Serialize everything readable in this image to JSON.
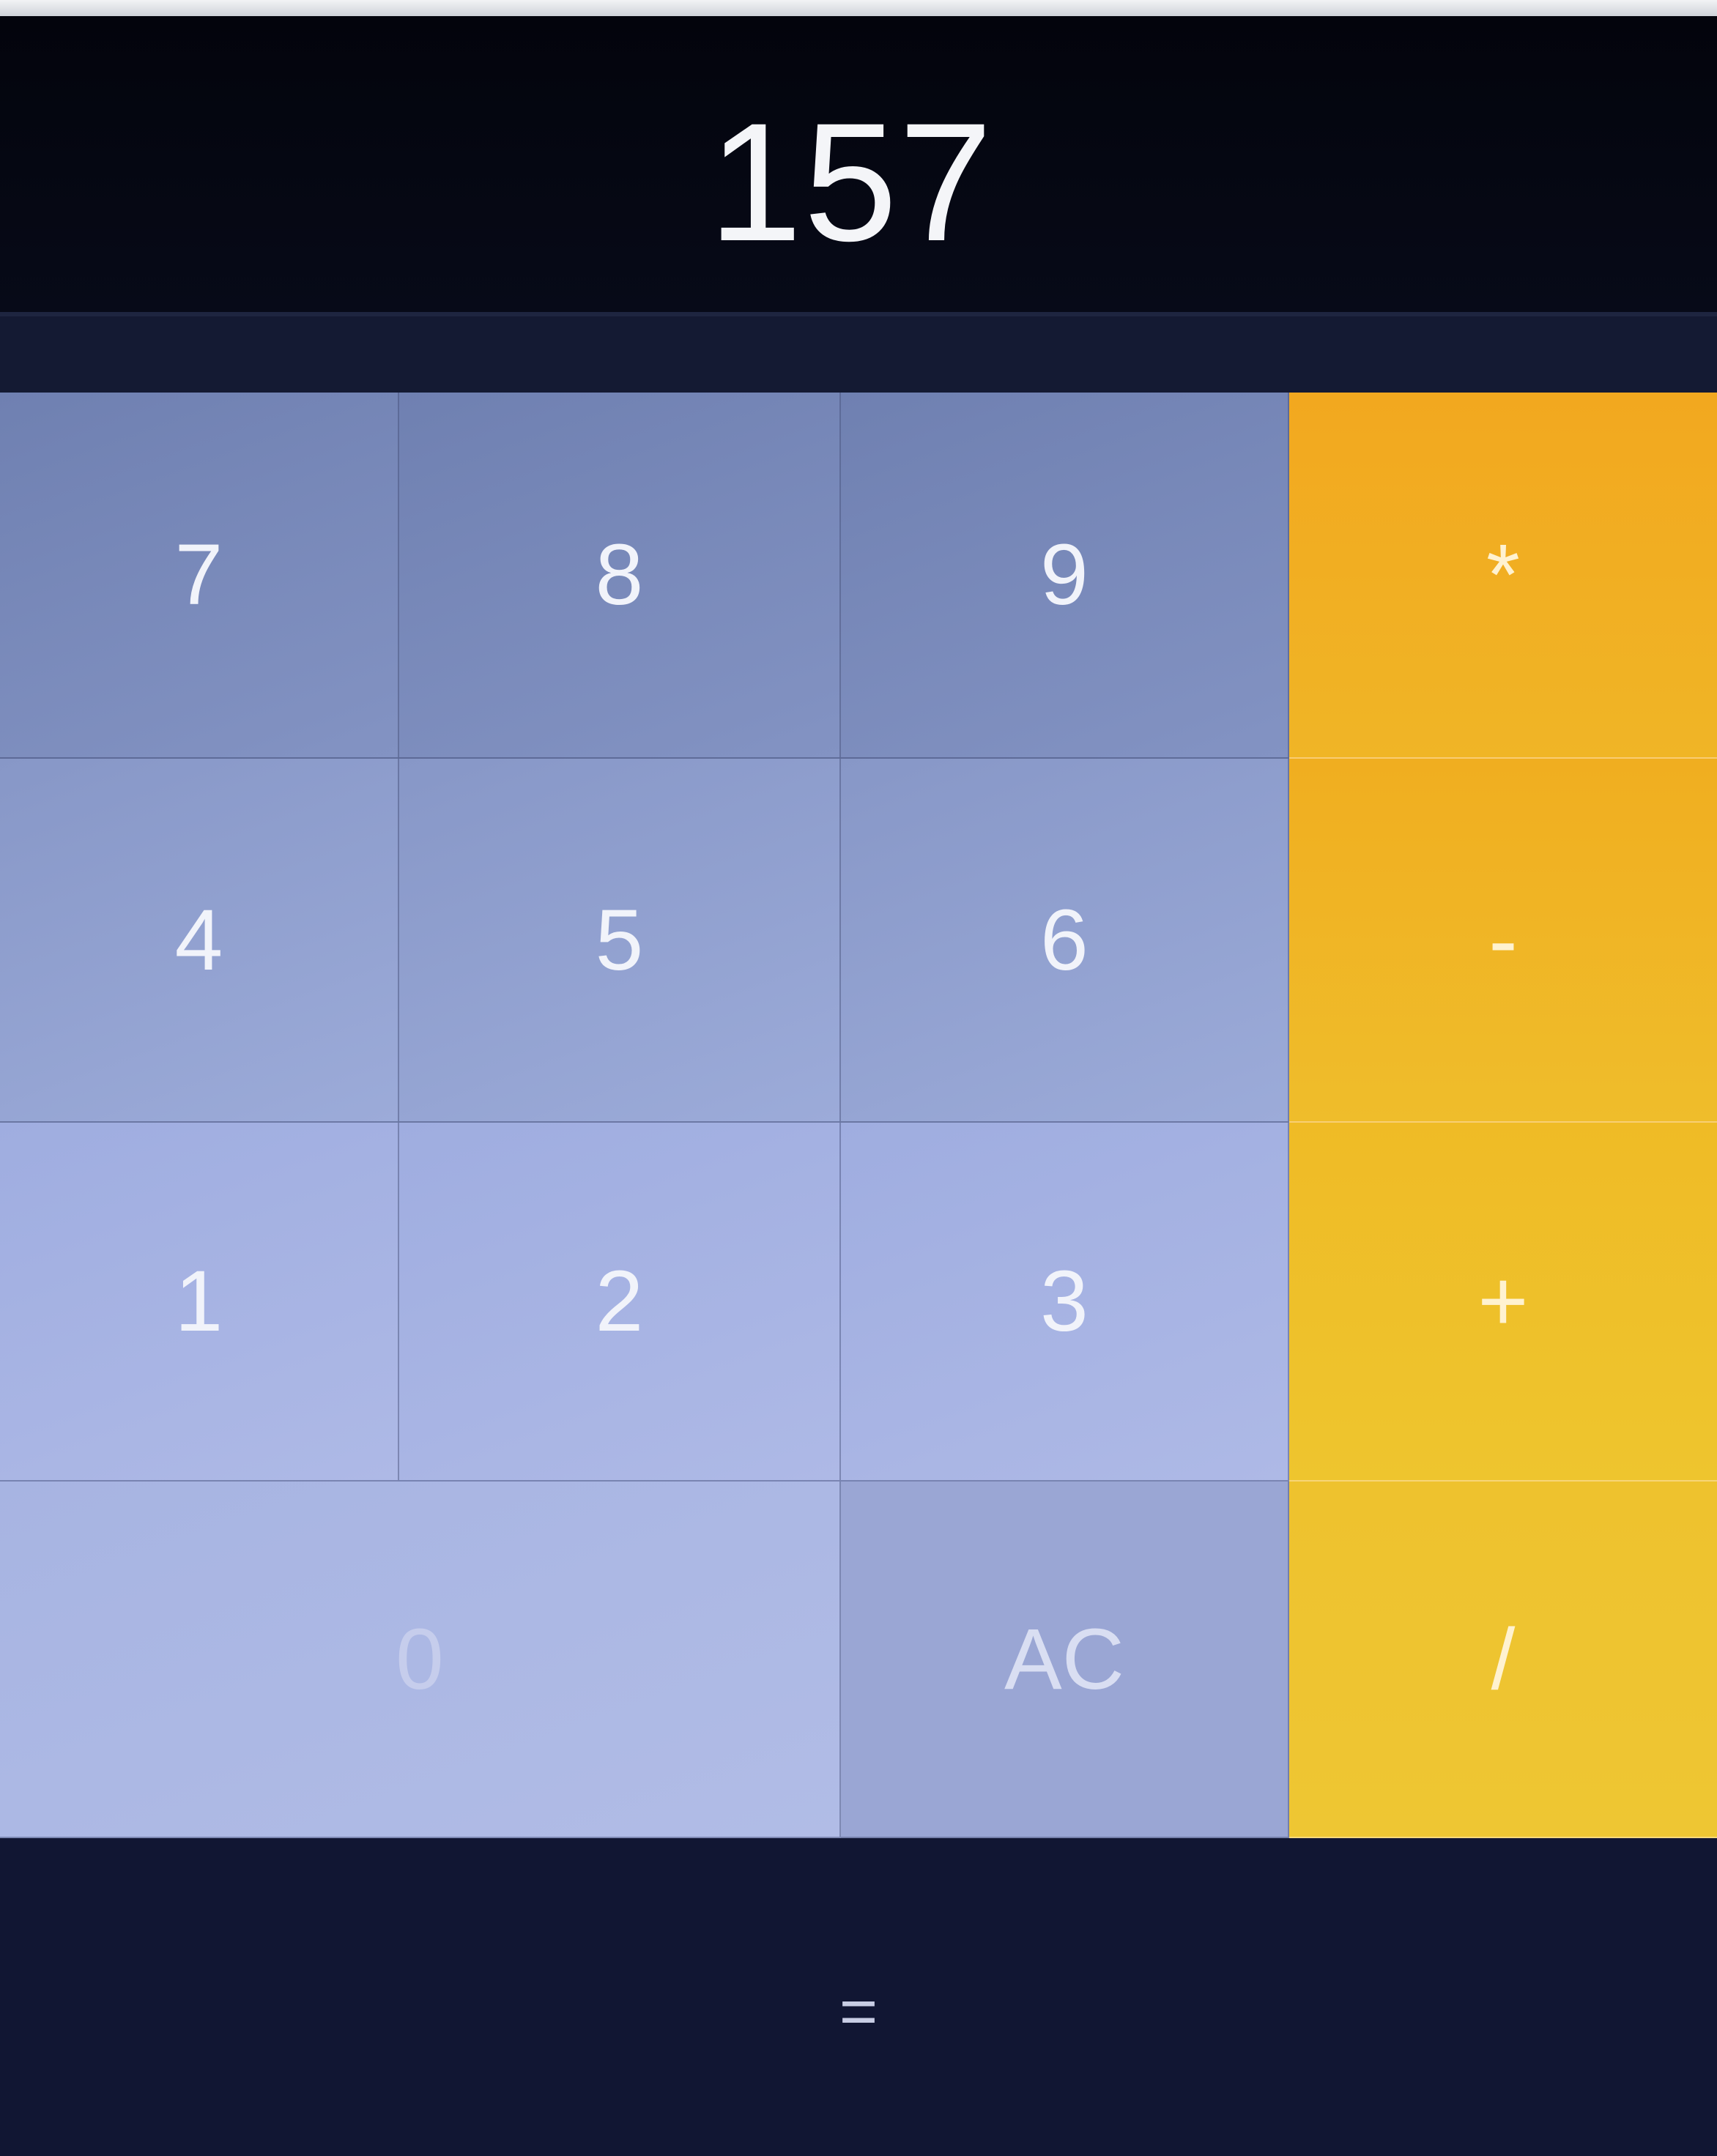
{
  "display": {
    "value": "157"
  },
  "keys": {
    "digits": {
      "seven": "7",
      "eight": "8",
      "nine": "9",
      "four": "4",
      "five": "5",
      "six": "6",
      "one": "1",
      "two": "2",
      "three": "3",
      "zero": "0"
    },
    "clear": "AC",
    "operators": {
      "multiply": "*",
      "subtract": "-",
      "add": "+",
      "divide": "/"
    },
    "equals": "="
  },
  "colors": {
    "display_bg": "#03040c",
    "digit_key": "#8f9dc7",
    "operator_key": "#f0b526",
    "equals_bg": "#111633",
    "text": "#f4f5f8"
  }
}
